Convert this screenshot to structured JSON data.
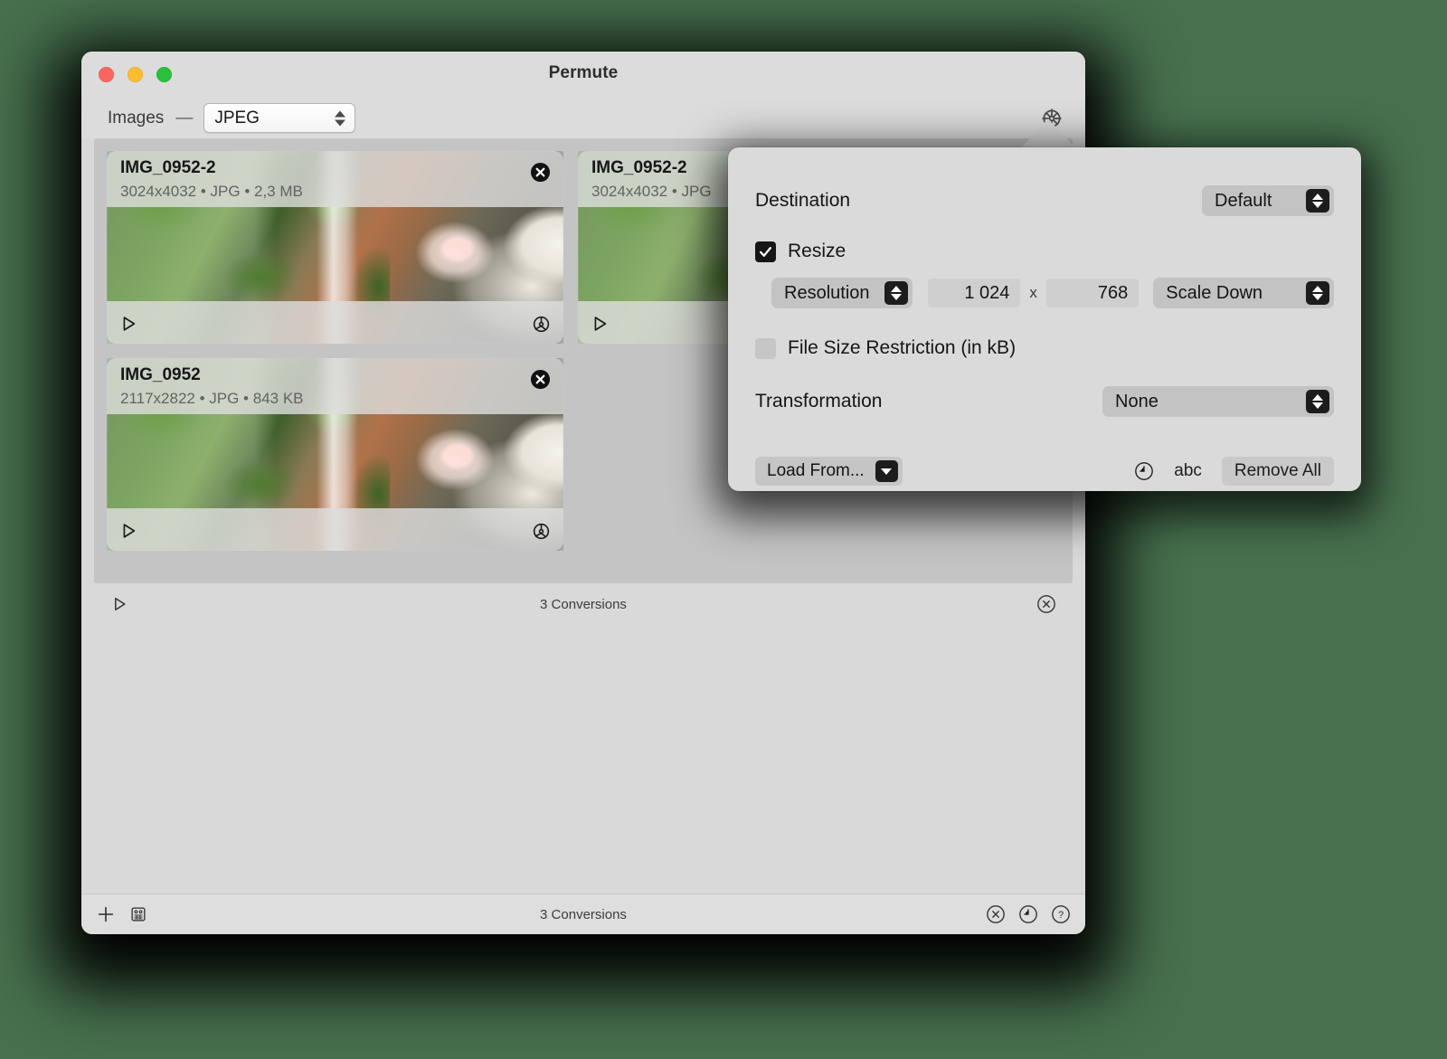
{
  "window": {
    "title": "Permute",
    "traffic_lights": [
      "close",
      "minimize",
      "zoom"
    ]
  },
  "toolbar": {
    "category_label": "Images",
    "separator": "—",
    "format_value": "JPEG",
    "settings_icon": "gear-icon"
  },
  "files": [
    {
      "name": "IMG_0952-2",
      "meta": "3024x4032 • JPG • 2,3 MB",
      "dimensions": "3024x4032",
      "format": "JPG",
      "size": "2,3 MB"
    },
    {
      "name": "IMG_0952-2",
      "meta": "3024x4032 • JPG",
      "dimensions": "3024x4032",
      "format": "JPG",
      "size": ""
    },
    {
      "name": "IMG_0952",
      "meta": "2117x2822 • JPG • 843 KB",
      "dimensions": "2117x2822",
      "format": "JPG",
      "size": "843 KB"
    }
  ],
  "mid_status": {
    "conversions": "3 Conversions",
    "play_icon": "play-icon",
    "cancel_icon": "cancel-circle-icon"
  },
  "bottom_bar": {
    "add_icon": "plus-icon",
    "robot_icon": "robot-icon",
    "conversions": "3 Conversions",
    "cancel_icon": "cancel-circle-icon",
    "history_icon": "clock-icon",
    "help_icon": "question-circle-icon"
  },
  "popover": {
    "destination": {
      "label": "Destination",
      "value": "Default"
    },
    "resize": {
      "label": "Resize",
      "checked": true,
      "mode": "Resolution",
      "width": "1 024",
      "separator": "x",
      "height": "768",
      "scale_mode": "Scale Down"
    },
    "file_size_restriction": {
      "label": "File Size Restriction (in kB)",
      "checked": false
    },
    "transformation": {
      "label": "Transformation",
      "value": "None"
    },
    "footer": {
      "load_from": "Load From...",
      "history_icon": "clock-icon",
      "sort_label": "abc",
      "remove_all": "Remove All"
    }
  },
  "colors": {
    "desktop_background": "#47704e",
    "window_chrome": "#dcdcdc",
    "window_body": "#d9d9d9",
    "file_area": "#c4c4c4",
    "popover_background": "#dadada",
    "control_fill": "#c3c3c3",
    "stepper_dark": "#1c1c1c",
    "traffic_red": "#f9655f",
    "traffic_yellow": "#fbbd2f",
    "traffic_green": "#2ac03b"
  }
}
